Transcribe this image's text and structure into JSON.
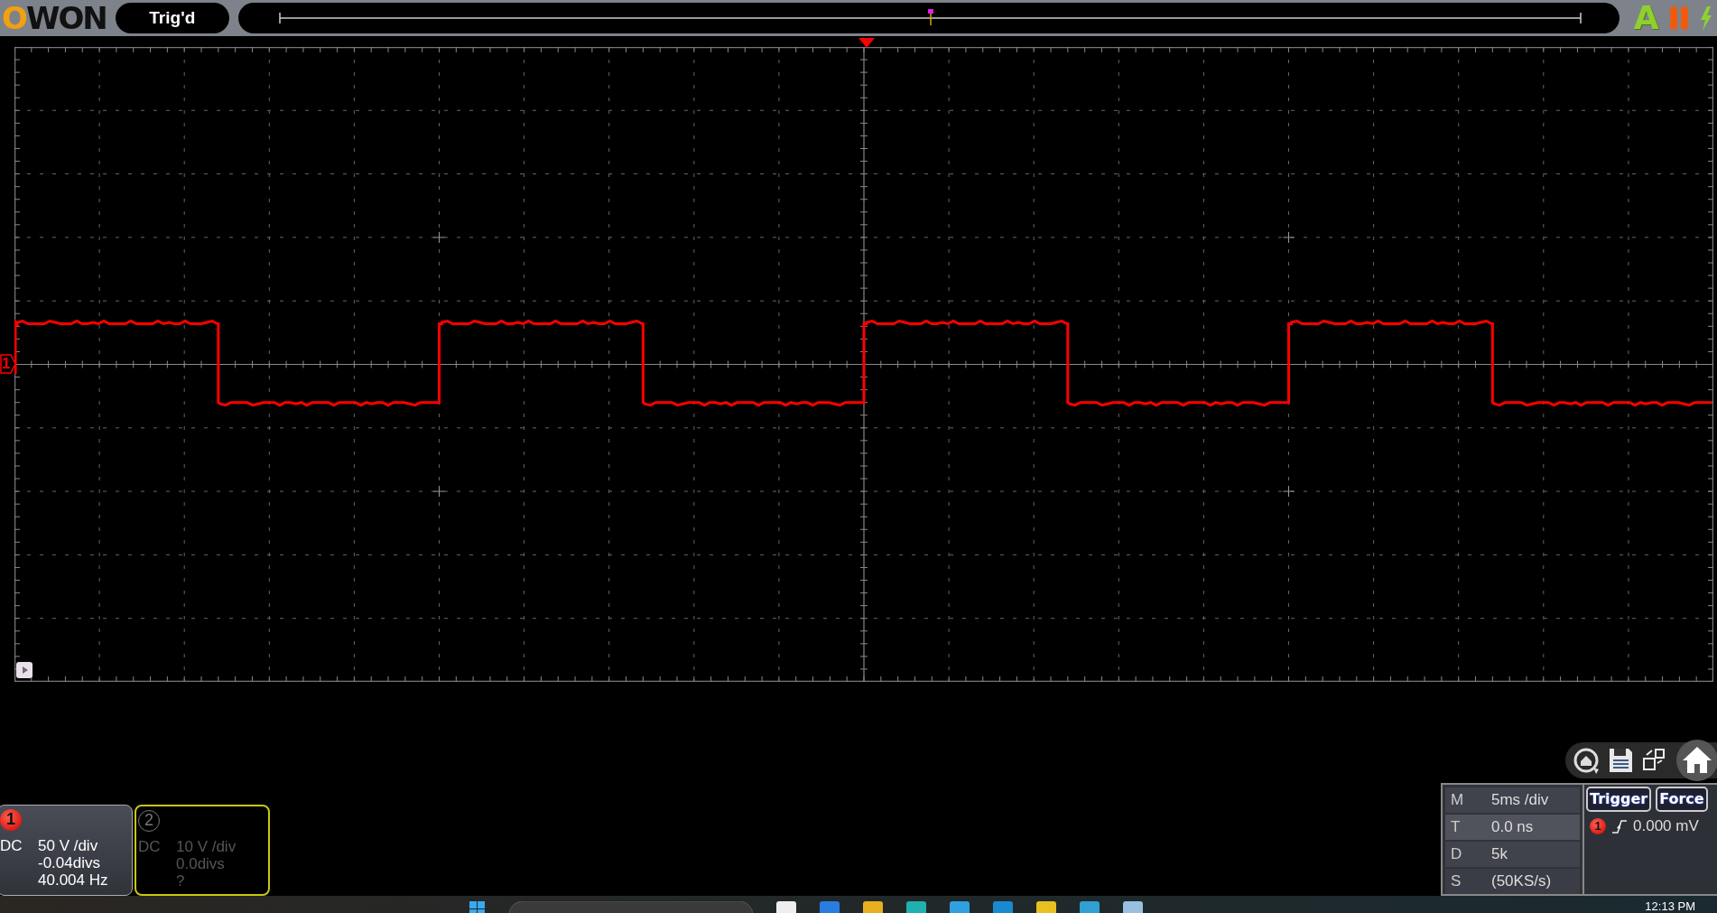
{
  "top_bar": {
    "brand": "OWON",
    "trigger_status": "Trig'd",
    "auto_button": "A"
  },
  "screen": {
    "ground_marker": "1"
  },
  "channels": [
    {
      "number": "1",
      "coupling": "DC",
      "scale": "50 V /div",
      "offset": "-0.04divs",
      "frequency": "40.004 Hz",
      "enabled": true
    },
    {
      "number": "2",
      "coupling": "DC",
      "scale": "10 V /div",
      "offset": "0.0divs",
      "frequency": "?",
      "enabled": false
    }
  ],
  "timebase": [
    {
      "label": "M",
      "value": "5ms /div"
    },
    {
      "label": "T",
      "value": "0.0 ns"
    },
    {
      "label": "D",
      "value": "5k"
    },
    {
      "label": "S",
      "value": "(50KS/s)"
    }
  ],
  "trigger": {
    "buttons": [
      "Trigger",
      "Force"
    ],
    "source": "1",
    "reading": "0.000 mV"
  },
  "taskbar": {
    "clock": "12:13 PM"
  }
}
